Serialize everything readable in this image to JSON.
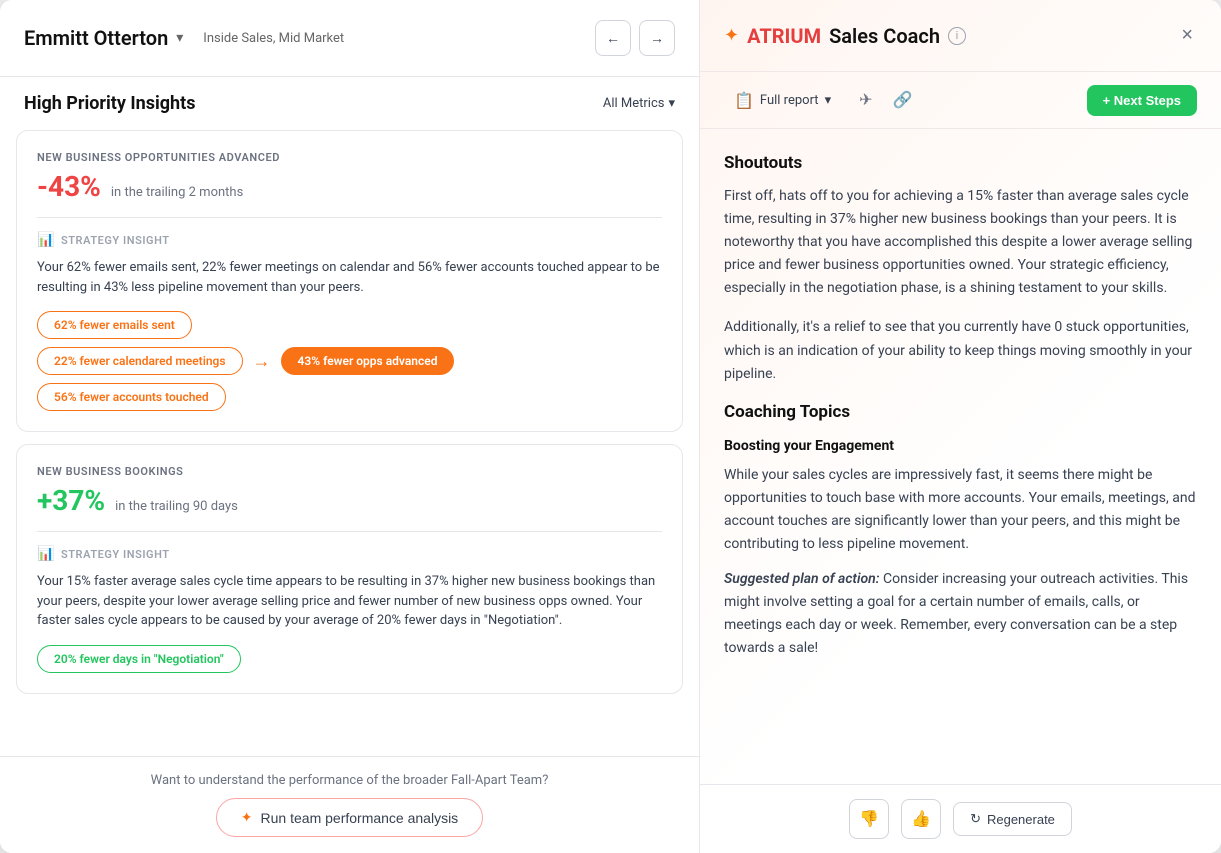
{
  "left": {
    "user": {
      "name": "Emmitt Otterton",
      "role": "Inside Sales, Mid Market"
    },
    "nav": {
      "back_label": "←",
      "forward_label": "→"
    },
    "insights_title": "High Priority Insights",
    "all_metrics_label": "All Metrics",
    "cards": [
      {
        "id": "card-1",
        "label": "NEW BUSINESS OPPORTUNITIES ADVANCED",
        "metric_pct": "-43%",
        "metric_type": "negative",
        "metric_subtitle": "in the trailing 2 months",
        "strategy_label": "STRATEGY INSIGHT",
        "insight_text": "Your 62% fewer emails sent, 22% fewer meetings on calendar and 56% fewer accounts touched appear to be resulting in 43% less pipeline movement than your peers.",
        "pills": [
          {
            "text": "62% fewer emails sent",
            "type": "outline",
            "row": 0
          },
          {
            "text": "22% fewer calendared meetings",
            "type": "outline",
            "row": 1
          },
          {
            "text": "43% fewer opps advanced",
            "type": "filled",
            "row": 1
          },
          {
            "text": "56% fewer accounts touched",
            "type": "outline",
            "row": 2
          }
        ]
      },
      {
        "id": "card-2",
        "label": "NEW BUSINESS BOOKINGS",
        "metric_pct": "+37%",
        "metric_type": "positive",
        "metric_subtitle": "in the trailing 90 days",
        "strategy_label": "STRATEGY INSIGHT",
        "insight_text": "Your 15% faster average sales cycle time appears to be resulting in 37% higher new business bookings than your peers, despite your lower average selling price and fewer number of new business opps owned. Your faster sales cycle appears to be caused by your average of 20% fewer days in \"Negotiation\".",
        "pills": [
          {
            "text": "20% fewer days in \"Negotiation\"",
            "type": "green",
            "row": 0
          }
        ]
      }
    ],
    "team_question": "Want to understand the performance of the broader Fall-Apart Team?",
    "run_analysis_label": "Run team performance analysis"
  },
  "right": {
    "header": {
      "atrium_text": "ATRIUM",
      "sales_coach_text": "Sales Coach",
      "close_label": "×"
    },
    "toolbar": {
      "full_report_label": "Full report",
      "chevron": "▾",
      "next_steps_label": "+ Next Steps"
    },
    "shoutouts_heading": "Shoutouts",
    "shoutouts_text_1": "First off, hats off to you for achieving a 15% faster than average sales cycle time, resulting in 37% higher new business bookings than your peers. It is noteworthy that you have accomplished this despite a lower average selling price and fewer business opportunities owned. Your strategic efficiency, especially in the negotiation phase, is a shining testament to your skills.",
    "shoutouts_text_2": "Additionally, it's a relief to see that you currently have 0 stuck opportunities, which is an indication of your ability to keep things moving smoothly in your pipeline.",
    "coaching_topics_heading": "Coaching Topics",
    "topic_heading": "Boosting your Engagement",
    "topic_text": "While your sales cycles are impressively fast, it seems there might be opportunities to touch base with more accounts. Your emails, meetings, and account touches are significantly lower than your peers, and this might be contributing to less pipeline movement.",
    "suggested_plan": "Suggested plan of action: Consider increasing your outreach activities. This might involve setting a goal for a certain number of emails, calls, or meetings each day or week. Remember, every conversation can be a step towards a sale!",
    "feedback": {
      "thumbs_down": "👎",
      "thumbs_up": "👍",
      "regenerate_label": "Regenerate"
    }
  }
}
